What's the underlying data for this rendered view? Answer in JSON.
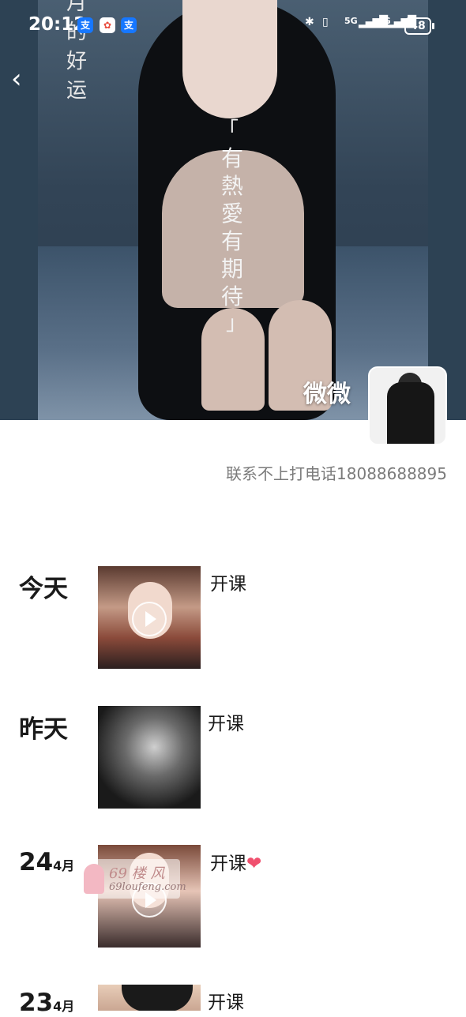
{
  "status_bar": {
    "time": "20:12",
    "app_icons": [
      "alipay-icon",
      "notes-icon",
      "alipay-icon"
    ],
    "network_5g": "5G",
    "network_4g": "4G",
    "battery": "48"
  },
  "cover": {
    "vertical_caption_lines": [
      "有",
      "熱",
      "愛",
      "有",
      "期",
      "待"
    ],
    "quote_open": "「",
    "quote_close": "」",
    "side_text_lines": [
      "月",
      "的",
      "好",
      "运"
    ]
  },
  "profile": {
    "nickname": "微微",
    "signature": "联系不上打电话18088688895"
  },
  "posts": [
    {
      "date": "今天",
      "caption": "开课",
      "has_video": true
    },
    {
      "date": "昨天",
      "caption": "开课",
      "has_video": false
    },
    {
      "day": "24",
      "month": "4月",
      "caption": "开课",
      "emoji": "❤",
      "has_video": true
    },
    {
      "day": "23",
      "month": "4月",
      "caption": "开课",
      "has_video": false
    }
  ],
  "watermark": {
    "line1": "69 楼 风",
    "line2": "69loufeng.com"
  }
}
